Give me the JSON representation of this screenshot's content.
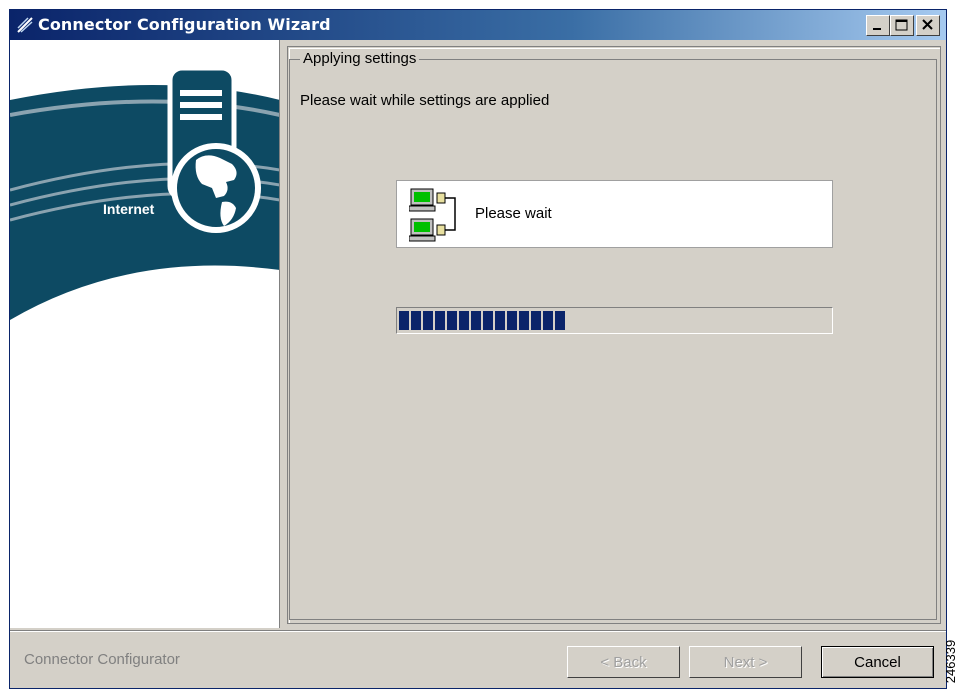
{
  "window": {
    "title": "Connector Configuration Wizard",
    "buttons": {
      "minimize": "minimize-icon",
      "maximize": "maximize-icon",
      "close": "close-icon"
    }
  },
  "banner": {
    "label": "Internet",
    "icons": [
      "server-icon",
      "globe-icon"
    ],
    "colors": {
      "arc": "#0d4a63",
      "stripe": "#8aa3b0"
    }
  },
  "step": {
    "heading": "Applying settings",
    "instruction": "Please wait while settings are applied",
    "status_label": "Please wait",
    "status_icon": "network-computers-icon",
    "progress": 0.4
  },
  "footer": {
    "app_name": "Connector Configurator",
    "back_label": "< Back",
    "next_label": "Next >",
    "cancel_label": "Cancel"
  },
  "watermark": "246339"
}
